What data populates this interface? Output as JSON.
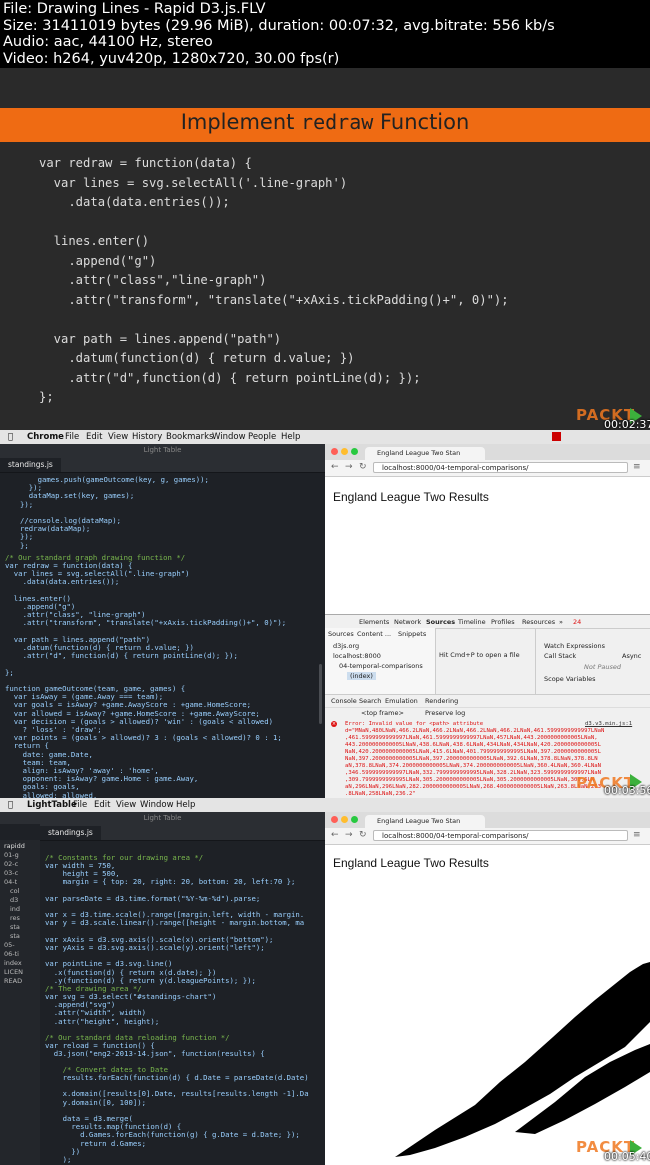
{
  "meta": {
    "line1": "File: Drawing Lines - Rapid D3.js.FLV",
    "line2": "Size: 31411019 bytes (29.96 MiB), duration: 00:07:32, avg.bitrate: 556 kb/s",
    "line3": "Audio: aac, 44100 Hz, stereo",
    "line4": "Video: h264, yuv420p, 1280x720, 30.00 fps(r)"
  },
  "frame1": {
    "title_pre": "Implement ",
    "title_mono": "redraw",
    "title_post": " Function",
    "code": "var redraw = function(data) {\n  var lines = svg.selectAll('.line-graph')\n    .data(data.entries());\n\n  lines.enter()\n    .append(\"g\")\n    .attr(\"class\",\"line-graph\")\n    .attr(\"transform\", \"translate(\"+xAxis.tickPadding()+\", 0)\");\n\n  var path = lines.append(\"path\")\n    .datum(function(d) { return d.value; })\n    .attr(\"d\",function(d) { return pointLine(d); });\n};",
    "logo": "PACKT",
    "logo_sub": "PUBLISHING",
    "timestamp": "00:02:37"
  },
  "frame2": {
    "menu": [
      "Chrome",
      "File",
      "Edit",
      "View",
      "History",
      "Bookmarks",
      "Window",
      "People",
      "Help"
    ],
    "editor_title": "Light Table",
    "editor_tab": "standings.js",
    "code_a": "    games.push(gameOutcome(key, g, games));\n  });\n  dataMap.set(key, games);\n});\n\n//console.log(dataMap);\nredraw(dataMap);\n});\n};",
    "comment1": "/* Our standard graph drawing function */",
    "code_b": "var redraw = function(data) {\n  var lines = svg.selectAll(\".line-graph\")\n    .data(data.entries());\n\n  lines.enter()\n    .append(\"g\")\n    .attr(\"class\", \"line-graph\")\n    .attr(\"transform\", \"translate(\"+xAxis.tickPadding()+\", 0)\");\n\n  var path = lines.append(\"path\")\n    .datum(function(d) { return d.value; })\n    .attr(\"d\", function(d) { return pointLine(d); });\n\n};\n\nfunction gameOutcome(team, game, games) {\n  var isAway = (game.Away === team);\n  var goals = isAway? +game.AwayScore : +game.HomeScore;\n  var allowed = isAway? +game.HomeScore : +game.AwayScore;\n  var decision = (goals > allowed)? 'win' : (goals < allowed)\n    ? 'loss' : 'draw';\n  var points = (goals > allowed)? 3 : (goals < allowed)? 0 : 1;\n  return {\n    date: game.Date,\n    team: team,\n    align: isAway? 'away' : 'home',\n    opponent: isAway? game.Home : game.Away,\n    goals: goals,\n    allowed: allowed,\n    venue: game.Venue,",
    "tab_title": "England League Two Stan",
    "url": "localhost:8000/04-temporal-comparisons/",
    "page_heading": "England League Two Results",
    "devtools_tabs": [
      "Elements",
      "Network",
      "Sources",
      "Timeline",
      "Profiles",
      "Resources",
      "»"
    ],
    "error_count": "24",
    "sources_tabs": [
      "Sources",
      "Content ...",
      "Snippets"
    ],
    "tree": [
      "d3js.org",
      "localhost:8000",
      "04-temporal-comparisons",
      "(index)"
    ],
    "hint": "Hit Cmd+P to open a file",
    "watch": "Watch Expressions",
    "callstack": "Call Stack",
    "async": "Async",
    "not_paused": "Not Paused",
    "scope": "Scope Variables",
    "console_tabs": [
      "Console",
      "Search",
      "Emulation",
      "Rendering"
    ],
    "top_frame": "<top frame>",
    "preserve_log": "Preserve log",
    "error1_head": "Error: Invalid value for <path> attribute",
    "error_src": "d3.v3.min.js:1",
    "error1_body": "d=\"MNaN,480LNaN,466.2LNaN,466.2LNaN,466.2LNaN,466.2LNaN,461.5999999999997LNaN\n,461.5999999999997LNaN,461.5999999999997LNaN,457LNaN,443.2000000000005LNaN,\n443.2000000000005LNaN,438.6LNaN,438.6LNaN,434LNaN,434LNaN,420.2000000000005L\nNaN,420.2000000000005LNaN,415.6LNaN,401.7999999999995LNaN,397.2000000000005L\nNaN,397.2000000000005LNaN,397.2000000000005LNaN,392.6LNaN,378.8LNaN,378.8LN\naN,378.8LNaN,374.2000000000005LNaN,374.2000000000005LNaN,360.4LNaN,360.4LNaN\n,346.5999999999997LNaN,332.7999999999995LNaN,328.2LNaN,323.5999999999997LNaN\n,309.7999999999995LNaN,305.2000000000005LNaN,305.2000000000005LNaN,300.6LN\naN,296LNaN,296LNaN,282.2000000000005LNaN,268.4000000000005LNaN,263.8LNaN,263\n.8LNaN,258LNaN,236.2\"",
    "error2_head": "Error: Invalid value for <path> attribute",
    "error2_body": "d=\"MNaN,475.4LNaN,461.5999999999997LNaN,461.5999999999997LNaN,447.79999999\n9995LNaN,434LNaN,420.2000000000005LNaN,420.2000000000005LNaN,406.4LNaN,",
    "timestamp": "00:03:56"
  },
  "frame3": {
    "menu": [
      "LightTable",
      "File",
      "Edit",
      "View",
      "Window",
      "Help"
    ],
    "editor_title": "Light Table",
    "sidebar": [
      "rapidd",
      "01-g",
      "02-c",
      "03-c",
      "04-t",
      "col",
      "d3",
      "ind",
      "res",
      "sta",
      "sta",
      "05-",
      "06-ti",
      "index",
      "LICEN",
      "READ"
    ],
    "editor_tab": "standings.js",
    "comment1": "/* Constants for our drawing area */",
    "code_a": "var width = 750,\n    height = 500,\n    margin = { top: 20, right: 20, bottom: 20, left:70 };\n\nvar parseDate = d3.time.format(\"%Y-%m-%d\").parse;\n\nvar x = d3.time.scale().range([margin.left, width - margin.\nvar y = d3.scale.linear().range([height - margin.bottom, ma\n\nvar xAxis = d3.svg.axis().scale(x).orient(\"bottom\");\nvar yAxis = d3.svg.axis().scale(y).orient(\"left\");\n\nvar pointLine = d3.svg.line()\n  .x(function(d) { return x(d.date); })\n  .y(function(d) { return y(d.leaguePoints); });",
    "comment2": "/* The drawing area */",
    "code_b": "var svg = d3.select(\"#standings-chart\")\n  .append(\"svg\")\n  .attr(\"width\", width)\n  .attr(\"height\", height);",
    "comment3": "/* Our standard data reloading function */",
    "code_c": "var reload = function() {\n  d3.json(\"eng2-2013-14.json\", function(results) {",
    "comment4": "    /* Convert dates to Date",
    "code_d": "    results.forEach(function(d) { d.Date = parseDate(d.Date)\n\n    x.domain([results[0].Date, results[results.length -1].Da\n    y.domain([0, 100]);\n\n    data = d3.merge(\n      results.map(function(d) {\n        d.Games.forEach(function(g) { g.Date = d.Date; });\n        return d.Games;\n      })\n    );",
    "tab_title": "England League Two Stan",
    "url": "localhost:8000/04-temporal-comparisons/",
    "page_heading": "England League Two Results",
    "logo": "PACKT",
    "logo_sub": "PUBLISHING",
    "timestamp": "00:05:40"
  },
  "colors": {
    "orange_band": "#ef6b13",
    "editor_bg": "#1e2126",
    "error_red": "#dd1111"
  }
}
